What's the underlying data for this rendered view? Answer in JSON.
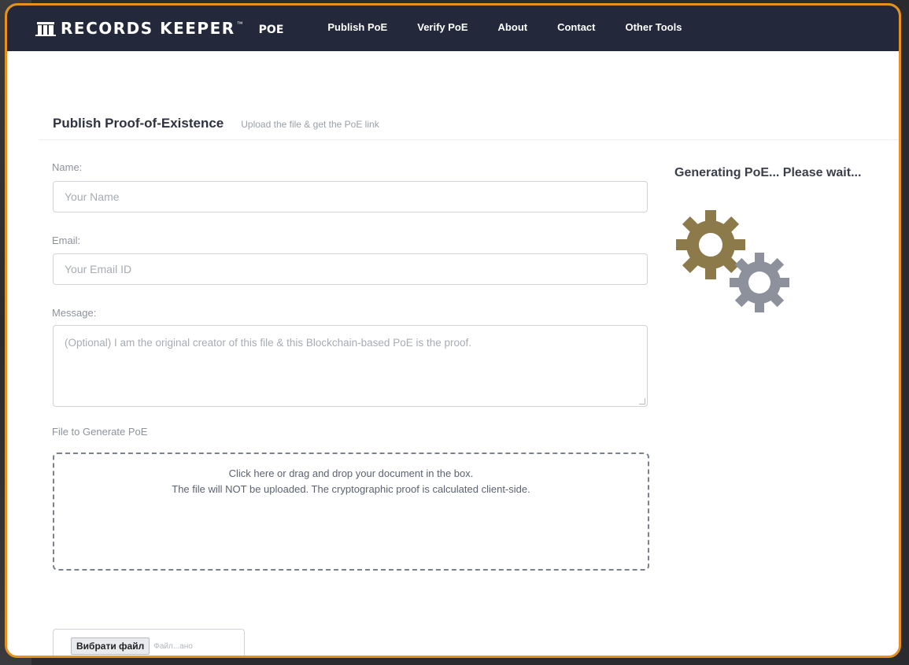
{
  "navbar": {
    "brand": "RECORDS KEEPER",
    "brand_tm": "™",
    "brand_sub": "POE",
    "links": [
      "Publish PoE",
      "Verify PoE",
      "About",
      "Contact",
      "Other Tools"
    ]
  },
  "page": {
    "title": "Publish Proof-of-Existence",
    "subtitle": "Upload the file & get the PoE link"
  },
  "form": {
    "name_label": "Name:",
    "name_placeholder": "Your Name",
    "email_label": "Email:",
    "email_placeholder": "Your Email ID",
    "message_label": "Message:",
    "message_placeholder": "(Optional) I am the original creator of this file & this Blockchain-based PoE is the proof.",
    "file_label": "File to Generate PoE",
    "dropzone_line1": "Click here or drag and drop your document in the box.",
    "dropzone_line2": "The file will NOT be uploaded. The cryptographic proof is calculated client-side.",
    "file_button": "Вибрати файл",
    "file_status": "Файл...ано"
  },
  "status": {
    "text": "Generating PoE... Please wait..."
  },
  "colors": {
    "frame": "#e8901c",
    "navbar": "#23283a",
    "gear_large": "#8c7a4a",
    "gear_small": "#8d919c"
  },
  "icons": [
    "logo-icon",
    "gear-large-icon",
    "gear-small-icon"
  ]
}
